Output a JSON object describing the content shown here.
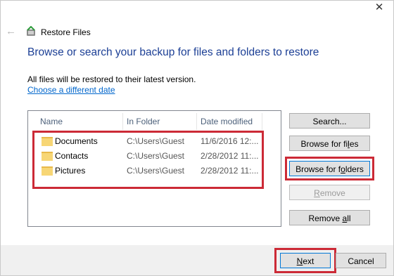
{
  "window": {
    "title": "Restore Files",
    "close_symbol": "✕",
    "back_symbol": "←"
  },
  "main": {
    "heading": "Browse or search your backup for files and folders to restore",
    "info_text": "All files will be restored to their latest version.",
    "date_link": "Choose a different date"
  },
  "list": {
    "columns": [
      "Name",
      "In Folder",
      "Date modified"
    ],
    "rows": [
      {
        "name": "Documents",
        "folder": "C:\\Users\\Guest",
        "date": "11/6/2016 12:..."
      },
      {
        "name": "Contacts",
        "folder": "C:\\Users\\Guest",
        "date": "2/28/2012 11:..."
      },
      {
        "name": "Pictures",
        "folder": "C:\\Users\\Guest",
        "date": "2/28/2012 11:..."
      }
    ]
  },
  "side_buttons": {
    "search": "Search...",
    "browse_files_pre": "Browse for fi",
    "browse_files_ul": "l",
    "browse_files_post": "es",
    "browse_folders_pre": "Browse for f",
    "browse_folders_ul": "o",
    "browse_folders_post": "lders",
    "remove_ul": "R",
    "remove_post": "emove",
    "remove_all_pre": "Remove ",
    "remove_all_ul": "a",
    "remove_all_post": "ll"
  },
  "footer": {
    "next_ul": "N",
    "next_post": "ext",
    "cancel": "Cancel"
  },
  "colors": {
    "heading": "#1c3f95",
    "link": "#0066cc",
    "highlight": "#cc2a36",
    "footer_bg": "#f0f0f0"
  },
  "icons": {
    "app": "restore-files-icon",
    "folder": "folder-icon",
    "back": "back-arrow-icon",
    "close": "close-icon"
  }
}
